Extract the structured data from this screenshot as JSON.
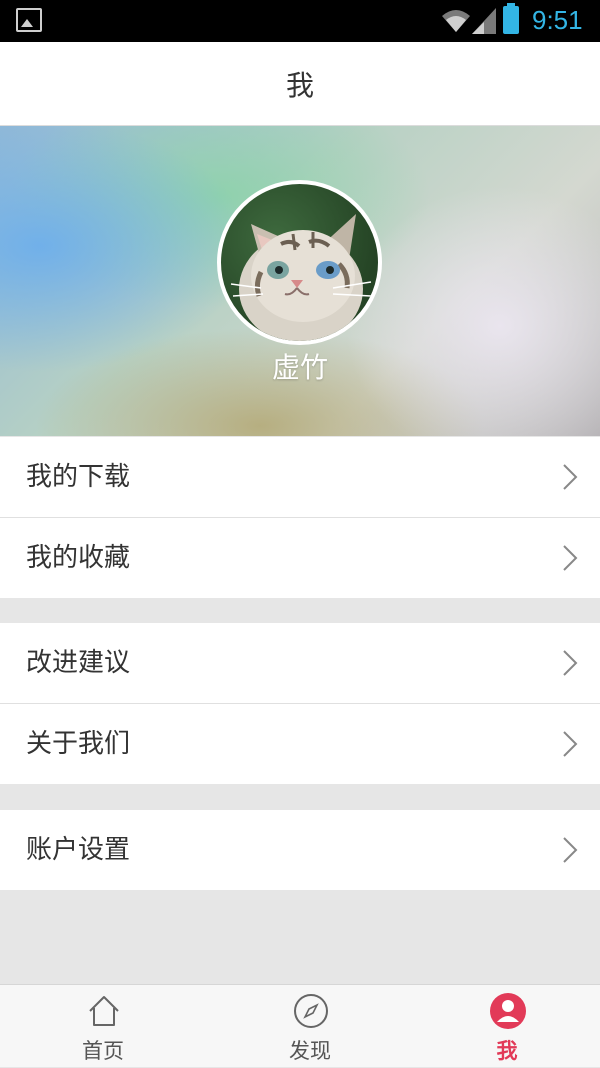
{
  "status_bar": {
    "time": "9:51"
  },
  "header": {
    "title": "我"
  },
  "profile": {
    "username": "虚竹"
  },
  "menu": {
    "downloads": "我的下载",
    "favorites": "我的收藏",
    "feedback": "改进建议",
    "about": "关于我们",
    "account_settings": "账户设置"
  },
  "tabs": [
    {
      "label": "首页",
      "icon": "home-icon",
      "active": false
    },
    {
      "label": "发现",
      "icon": "compass-icon",
      "active": false
    },
    {
      "label": "我",
      "icon": "user-icon",
      "active": true
    }
  ],
  "colors": {
    "accent": "#e23a58",
    "status_time": "#33b5e5"
  }
}
